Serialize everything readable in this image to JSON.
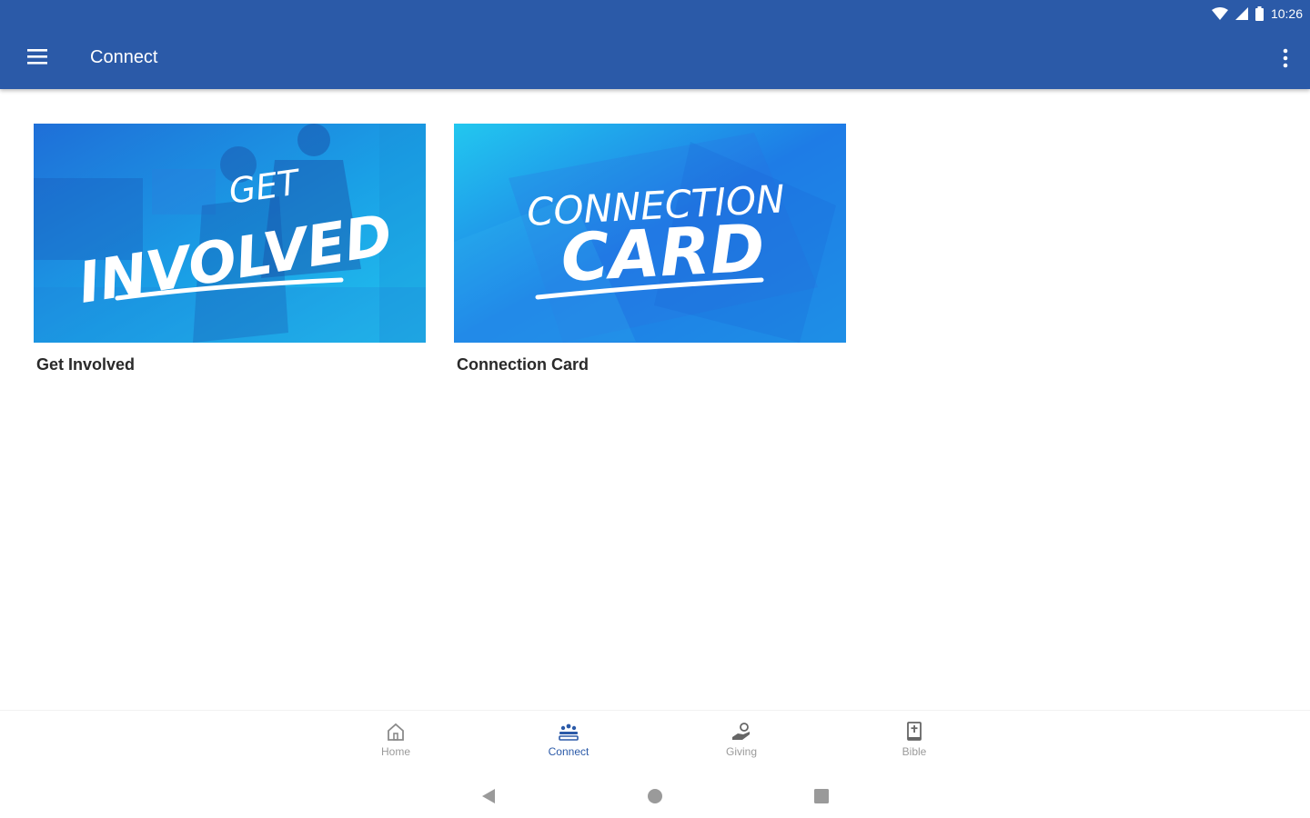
{
  "status_bar": {
    "time": "10:26"
  },
  "app_bar": {
    "title": "Connect"
  },
  "cards": [
    {
      "label": "Get Involved",
      "art_line1": "GET",
      "art_line2": "INVOLVED"
    },
    {
      "label": "Connection Card",
      "art_line1": "CONNECTION",
      "art_line2": "CARD"
    }
  ],
  "bottom_nav": [
    {
      "label": "Home",
      "icon": "home-icon",
      "active": false
    },
    {
      "label": "Connect",
      "icon": "connect-icon",
      "active": true
    },
    {
      "label": "Giving",
      "icon": "giving-icon",
      "active": false
    },
    {
      "label": "Bible",
      "icon": "bible-icon",
      "active": false
    }
  ],
  "colors": {
    "primary": "#2b5aa8",
    "inactive": "#9a9a9a",
    "card_blue": "#1e90e8",
    "card_cyan": "#22c7ef"
  }
}
